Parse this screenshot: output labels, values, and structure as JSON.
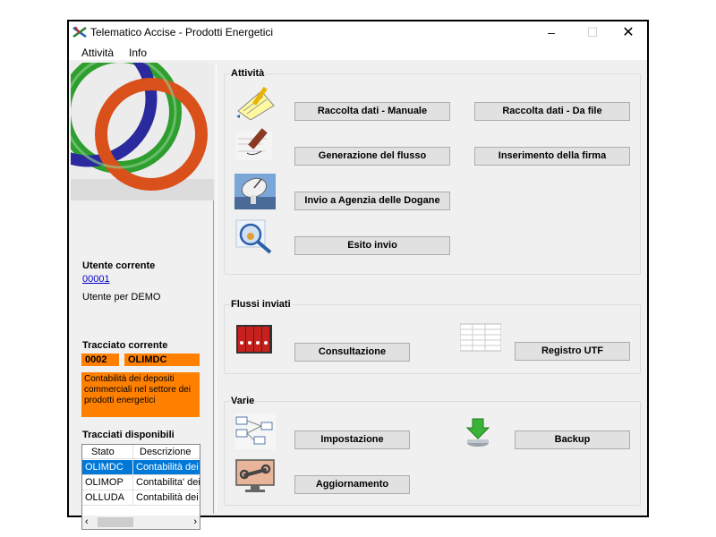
{
  "window": {
    "title": "Telematico Accise - Prodotti Energetici",
    "controls": {
      "minimize": "–",
      "maximize": "☐",
      "close": "✕"
    }
  },
  "menu": [
    "Attività",
    "Info"
  ],
  "left": {
    "utente_title": "Utente corrente",
    "utente_code": "00001",
    "utente_desc": "Utente per DEMO",
    "tracciato_title": "Tracciato corrente",
    "tracciato_code": "0002",
    "tracciato_name": "OLIMDC",
    "tracciato_desc": "Contabilità dei depositi commerciali nel settore dei prodotti energetici",
    "disponibili_title": "Tracciati disponibili",
    "list": {
      "headers": [
        "Stato",
        "Descrizione"
      ],
      "rows": [
        {
          "code": "OLIMDC",
          "desc": "Contabilità dei depositi",
          "selected": true
        },
        {
          "code": "OLIMOP",
          "desc": "Contabilita' dei depositi",
          "selected": false
        },
        {
          "code": "OLLUDA",
          "desc": "Contabilità dei depositi",
          "selected": false
        }
      ]
    }
  },
  "groups": {
    "attivita": {
      "title": "Attività",
      "buttons": {
        "raccolta_manuale": "Raccolta dati - Manuale",
        "raccolta_file": "Raccolta dati - Da file",
        "generazione": "Generazione del flusso",
        "firma": "Inserimento della firma",
        "invio": "Invio a Agenzia delle Dogane",
        "esito": "Esito invio"
      }
    },
    "flussi": {
      "title": "Flussi inviati",
      "buttons": {
        "consultazione": "Consultazione",
        "registro": "Registro UTF"
      }
    },
    "varie": {
      "title": "Varie",
      "buttons": {
        "impostazione": "Impostazione",
        "backup": "Backup",
        "aggiornamento": "Aggiornamento"
      }
    }
  },
  "colors": {
    "accent_orange": "#ff8000",
    "selection_blue": "#0078d7",
    "link_blue": "#0000cc"
  }
}
